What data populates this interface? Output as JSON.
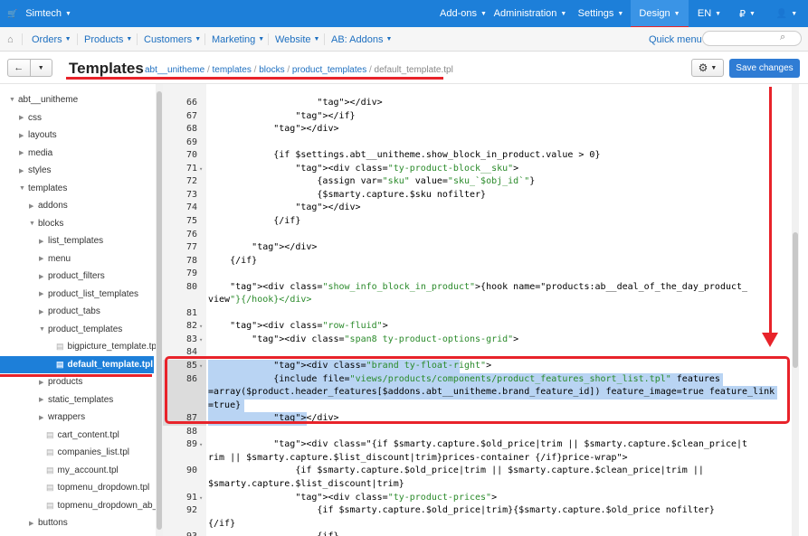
{
  "topbar": {
    "brand": "Simtech",
    "menu": [
      {
        "label": "Add-ons"
      },
      {
        "label": "Administration"
      },
      {
        "label": "Settings"
      },
      {
        "label": "Design",
        "active": true
      },
      {
        "label": "EN"
      },
      {
        "label": "₽"
      },
      {
        "label": "user-icon"
      }
    ]
  },
  "subnav": {
    "items": [
      {
        "label": "Orders"
      },
      {
        "label": "Products"
      },
      {
        "label": "Customers"
      },
      {
        "label": "Marketing"
      },
      {
        "label": "Website"
      },
      {
        "label": "AB: Addons"
      }
    ],
    "quick_menu": "Quick menu",
    "search_placeholder": ""
  },
  "toolbar": {
    "title": "Templates",
    "breadcrumbs": [
      "abt__unitheme",
      "templates",
      "blocks",
      "product_templates",
      "default_template.tpl"
    ],
    "save_label": "Save changes"
  },
  "tree": [
    {
      "label": "abt__unitheme",
      "depth": 0,
      "kind": "folder-open"
    },
    {
      "label": "css",
      "depth": 1,
      "kind": "folder"
    },
    {
      "label": "layouts",
      "depth": 1,
      "kind": "folder"
    },
    {
      "label": "media",
      "depth": 1,
      "kind": "folder"
    },
    {
      "label": "styles",
      "depth": 1,
      "kind": "folder"
    },
    {
      "label": "templates",
      "depth": 1,
      "kind": "folder-open"
    },
    {
      "label": "addons",
      "depth": 2,
      "kind": "folder"
    },
    {
      "label": "blocks",
      "depth": 2,
      "kind": "folder-open"
    },
    {
      "label": "list_templates",
      "depth": 3,
      "kind": "folder"
    },
    {
      "label": "menu",
      "depth": 3,
      "kind": "folder"
    },
    {
      "label": "product_filters",
      "depth": 3,
      "kind": "folder"
    },
    {
      "label": "product_list_templates",
      "depth": 3,
      "kind": "folder"
    },
    {
      "label": "product_tabs",
      "depth": 3,
      "kind": "folder"
    },
    {
      "label": "product_templates",
      "depth": 3,
      "kind": "folder-open"
    },
    {
      "label": "bigpicture_template.tpl",
      "depth": 4,
      "kind": "file"
    },
    {
      "label": "default_template.tpl",
      "depth": 4,
      "kind": "file",
      "selected": true
    },
    {
      "label": "products",
      "depth": 3,
      "kind": "folder"
    },
    {
      "label": "static_templates",
      "depth": 3,
      "kind": "folder"
    },
    {
      "label": "wrappers",
      "depth": 3,
      "kind": "folder"
    },
    {
      "label": "cart_content.tpl",
      "depth": 3,
      "kind": "file"
    },
    {
      "label": "companies_list.tpl",
      "depth": 3,
      "kind": "file"
    },
    {
      "label": "my_account.tpl",
      "depth": 3,
      "kind": "file"
    },
    {
      "label": "topmenu_dropdown.tpl",
      "depth": 3,
      "kind": "file"
    },
    {
      "label": "topmenu_dropdown_ab__...",
      "depth": 3,
      "kind": "file"
    },
    {
      "label": "buttons",
      "depth": 2,
      "kind": "folder"
    }
  ],
  "code_lines": [
    {
      "n": "66",
      "fold": false,
      "text": "                    </div>"
    },
    {
      "n": "67",
      "fold": false,
      "text": "                </if}"
    },
    {
      "n": "68",
      "fold": false,
      "text": "            </div>"
    },
    {
      "n": "69",
      "fold": false,
      "text": ""
    },
    {
      "n": "70",
      "fold": false,
      "text": "            {if $settings.abt__unitheme.show_block_in_product.value > 0}"
    },
    {
      "n": "71",
      "fold": true,
      "text": "                <div class=\"ty-product-block__sku\">"
    },
    {
      "n": "72",
      "fold": false,
      "text": "                    {assign var=\"sku\" value=\"sku_`$obj_id`\"}"
    },
    {
      "n": "73",
      "fold": false,
      "text": "                    {$smarty.capture.$sku nofilter}"
    },
    {
      "n": "74",
      "fold": false,
      "text": "                </div>"
    },
    {
      "n": "75",
      "fold": false,
      "text": "            {/if}"
    },
    {
      "n": "76",
      "fold": false,
      "text": ""
    },
    {
      "n": "77",
      "fold": false,
      "text": "        </div>"
    },
    {
      "n": "78",
      "fold": false,
      "text": "    {/if}"
    },
    {
      "n": "79",
      "fold": false,
      "text": ""
    },
    {
      "n": "80",
      "fold": false,
      "text": "    <div class=\"show_info_block_in_product\">{hook name=\"products:ab__deal_of_the_day_product_"
    },
    {
      "n": "",
      "fold": false,
      "text": "view\"}{/hook}</div>"
    },
    {
      "n": "81",
      "fold": false,
      "text": ""
    },
    {
      "n": "82",
      "fold": true,
      "text": "    <div class=\"row-fluid\">"
    },
    {
      "n": "83",
      "fold": true,
      "text": "        <div class=\"span8 ty-product-options-grid\">"
    },
    {
      "n": "84",
      "fold": false,
      "text": ""
    },
    {
      "n": "85",
      "fold": true,
      "text": "            <div class=\"brand ty-float-right\">",
      "hl": true
    },
    {
      "n": "86",
      "fold": false,
      "text": "            {include file=\"views/products/components/product_features_short_list.tpl\" features",
      "hl": true
    },
    {
      "n": "",
      "fold": false,
      "text": "=array($product.header_features[$addons.abt__unitheme.brand_feature_id]) feature_image=true feature_link",
      "hl": true
    },
    {
      "n": "",
      "fold": false,
      "text": "=true}",
      "hl": true
    },
    {
      "n": "87",
      "fold": false,
      "text": "            </div>",
      "hl": true
    },
    {
      "n": "88",
      "fold": false,
      "text": ""
    },
    {
      "n": "89",
      "fold": true,
      "text": "            <div class=\"{if $smarty.capture.$old_price|trim || $smarty.capture.$clean_price|t"
    },
    {
      "n": "",
      "fold": false,
      "text": "rim || $smarty.capture.$list_discount|trim}prices-container {/if}price-wrap\">"
    },
    {
      "n": "90",
      "fold": false,
      "text": "                {if $smarty.capture.$old_price|trim || $smarty.capture.$clean_price|trim ||"
    },
    {
      "n": "",
      "fold": false,
      "text": "$smarty.capture.$list_discount|trim}"
    },
    {
      "n": "91",
      "fold": true,
      "text": "                <div class=\"ty-product-prices\">"
    },
    {
      "n": "92",
      "fold": false,
      "text": "                    {if $smarty.capture.$old_price|trim}{$smarty.capture.$old_price nofilter}"
    },
    {
      "n": "",
      "fold": false,
      "text": "{/if}"
    },
    {
      "n": "93",
      "fold": false,
      "text": "                    {if}"
    }
  ]
}
